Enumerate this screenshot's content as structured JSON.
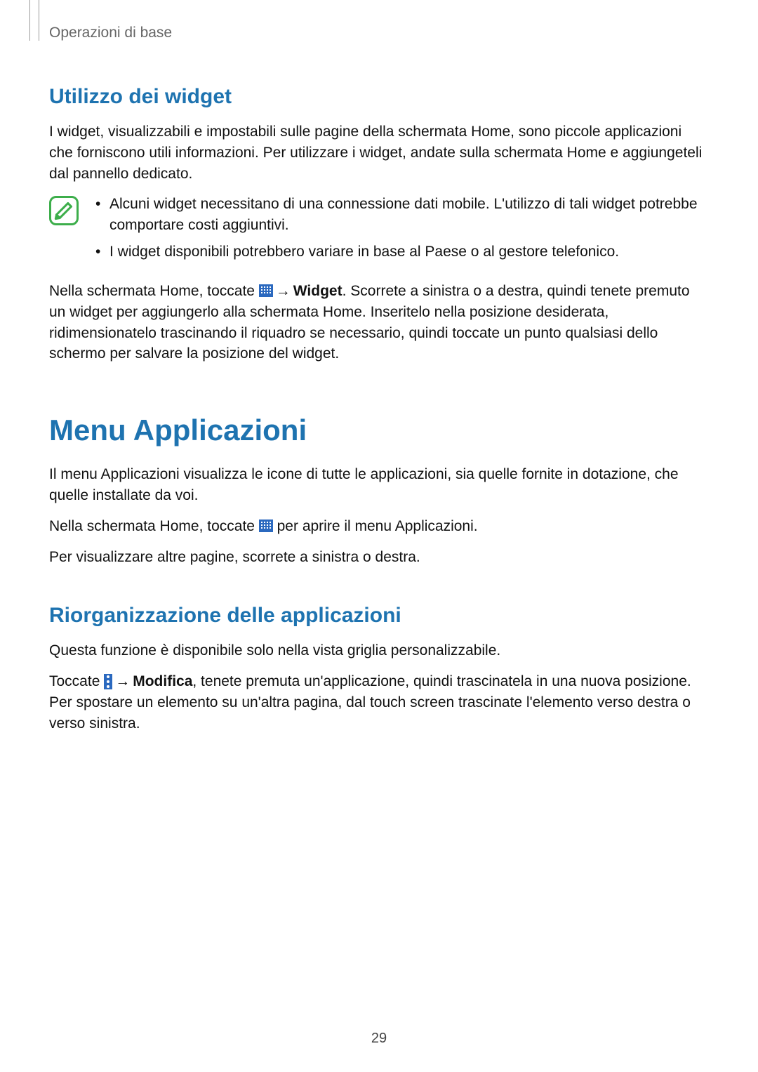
{
  "running_head": "Operazioni di base",
  "section_widget": {
    "title": "Utilizzo dei widget",
    "intro": "I widget, visualizzabili e impostabili sulle pagine della schermata Home, sono piccole applicazioni che forniscono utili informazioni. Per utilizzare i widget, andate sulla schermata Home e aggiungeteli dal pannello dedicato.",
    "note_items": [
      "Alcuni widget necessitano di una connessione dati mobile. L'utilizzo di tali widget potrebbe comportare costi aggiuntivi.",
      "I widget disponibili potrebbero variare in base al Paese o al gestore telefonico."
    ],
    "steps_pre": "Nella schermata Home, toccate ",
    "steps_arrow": "→",
    "steps_bold": "Widget",
    "steps_post": ". Scorrete a sinistra o a destra, quindi tenete premuto un widget per aggiungerlo alla schermata Home. Inseritelo nella posizione desiderata, ridimensionatelo trascinando il riquadro se necessario, quindi toccate un punto qualsiasi dello schermo per salvare la posizione del widget."
  },
  "section_menu": {
    "title": "Menu Applicazioni",
    "p1": "Il menu Applicazioni visualizza le icone di tutte le applicazioni, sia quelle fornite in dotazione, che quelle installate da voi.",
    "p2_pre": "Nella schermata Home, toccate ",
    "p2_post": " per aprire il menu Applicazioni.",
    "p3": "Per visualizzare altre pagine, scorrete a sinistra o destra."
  },
  "section_reorg": {
    "title": "Riorganizzazione delle applicazioni",
    "p1": "Questa funzione è disponibile solo nella vista griglia personalizzabile.",
    "p2_pre": "Toccate ",
    "p2_arrow": "→",
    "p2_bold": "Modifica",
    "p2_post": ", tenete premuta un'applicazione, quindi trascinatela in una nuova posizione. Per spostare un elemento su un'altra pagina, dal touch screen trascinate l'elemento verso destra o verso sinistra."
  },
  "page_number": "29"
}
